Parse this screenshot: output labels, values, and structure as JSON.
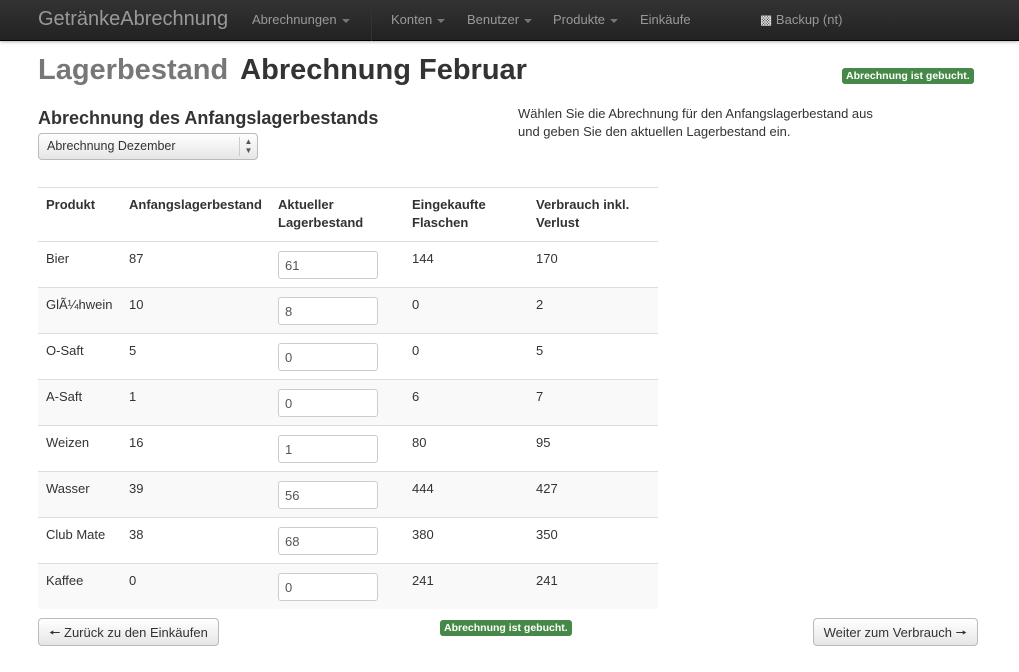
{
  "navbar": {
    "brand": "GetränkeAbrechnung",
    "items": [
      {
        "label": "Abrechnungen",
        "dropdown": true
      },
      {
        "label": "Konten",
        "dropdown": true
      },
      {
        "label": "Benutzer",
        "dropdown": true
      },
      {
        "label": "Produkte",
        "dropdown": true
      },
      {
        "label": "Einkäufe",
        "dropdown": false
      }
    ],
    "backup": "Backup (nt)"
  },
  "page": {
    "title_muted": "Lagerbestand",
    "title": "Abrechnung Februar",
    "status_badge": "Abrechnung ist gebucht."
  },
  "start_section": {
    "heading": "Abrechnung des Anfangslagerbestands",
    "select_value": "Abrechnung Dezember",
    "help": "Wählen Sie die Abrechnung für den Anfangslagerbestand aus und geben Sie den aktuellen Lagerbestand ein."
  },
  "table": {
    "headers": [
      "Produkt",
      "Anfangslagerbestand",
      "Aktueller Lagerbestand",
      "Eingekaufte Flaschen",
      "Verbrauch inkl. Verlust"
    ],
    "rows": [
      [
        "Bier",
        "87",
        "61",
        "144",
        "170"
      ],
      [
        "GlÃ¼hwein",
        "10",
        "8",
        "0",
        "2"
      ],
      [
        "O-Saft",
        "5",
        "0",
        "0",
        "5"
      ],
      [
        "A-Saft",
        "1",
        "0",
        "6",
        "7"
      ],
      [
        "Weizen",
        "16",
        "1",
        "80",
        "95"
      ],
      [
        "Wasser",
        "39",
        "56",
        "444",
        "427"
      ],
      [
        "Club Mate",
        "38",
        "68",
        "380",
        "350"
      ],
      [
        "Kaffee",
        "0",
        "0",
        "241",
        "241"
      ]
    ]
  },
  "footer": {
    "back": "Zurück zu den Einkäufen",
    "status": "Abrechnung ist gebucht.",
    "next": "Weiter zum Verbrauch"
  },
  "colors": {
    "success": "#468847",
    "navbar": "#222222"
  }
}
